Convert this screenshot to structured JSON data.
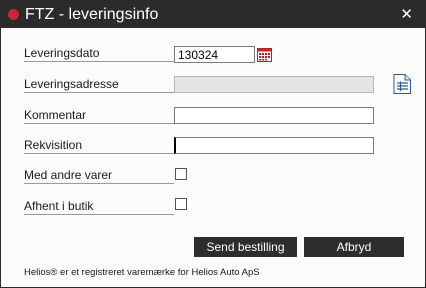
{
  "window": {
    "title": "FTZ - leveringsinfo",
    "close_glyph": "✕",
    "accent_color": "#c8243a"
  },
  "form": {
    "leveringsdato": {
      "label": "Leveringsdato",
      "value": "130324"
    },
    "leveringsadresse": {
      "label": "Leveringsadresse",
      "value": ""
    },
    "kommentar": {
      "label": "Kommentar",
      "value": ""
    },
    "rekvisition": {
      "label": "Rekvisition",
      "value": ""
    },
    "med_andre_varer": {
      "label": "Med andre varer",
      "checked": false
    },
    "afhent_i_butik": {
      "label": "Afhent i butik",
      "checked": false
    }
  },
  "icons": {
    "date_picker": "calendar-icon",
    "address_book": "address-list-icon"
  },
  "buttons": {
    "send": "Send bestilling",
    "cancel": "Afbryd"
  },
  "footer": "Helios® er et registreret varemærke for Helios Auto ApS"
}
